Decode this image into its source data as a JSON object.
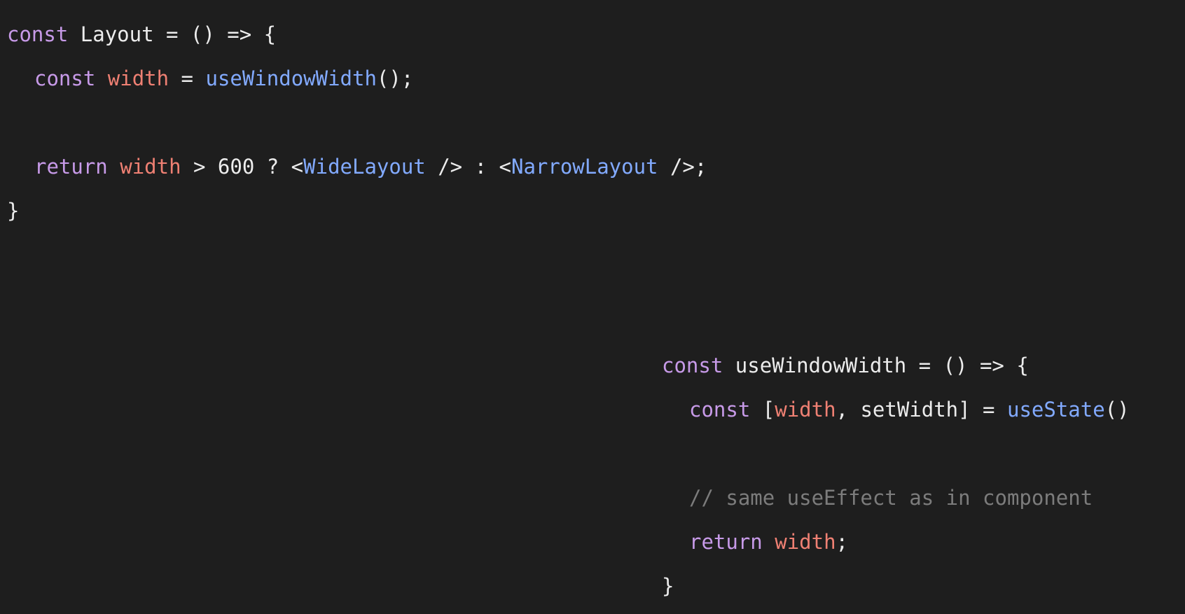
{
  "colors": {
    "background": "#1e1e1e",
    "keyword": "#c79ae8",
    "variable": "#ef8073",
    "function": "#82aaff",
    "plain": "#ececec",
    "comment": "#7c7c7c"
  },
  "layout_snippet": {
    "line1": {
      "kw": "const",
      "name": " Layout = () => {"
    },
    "line2": {
      "kw": "const",
      "var": "width",
      "eq": " = ",
      "fn": "useWindowWidth",
      "end": "();"
    },
    "line4": {
      "kw": "return",
      "var": "width",
      "mid": " > 600 ? <",
      "tag1": "WideLayout",
      "mid2": " /> : <",
      "tag2": "NarrowLayout",
      "end": " />;"
    },
    "line5": {
      "close": "}"
    }
  },
  "hook_snippet": {
    "line1": {
      "kw": "const",
      "name": " useWindowWidth = () => {"
    },
    "line2": {
      "kw": "const",
      "open": " [",
      "var": "width",
      "mid": ", setWidth] = ",
      "fn": "useState",
      "end": "()"
    },
    "line4": {
      "comment": "// same useEffect as in component"
    },
    "line5": {
      "kw": "return",
      "var": "width",
      "end": ";"
    },
    "line6": {
      "close": "}"
    }
  }
}
